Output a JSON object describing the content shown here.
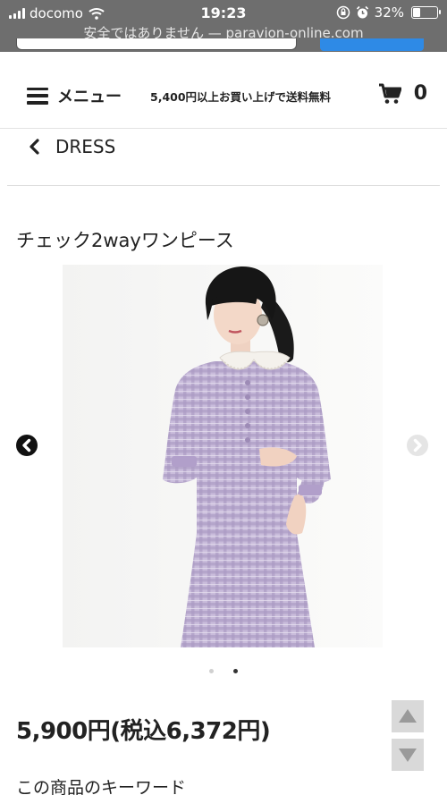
{
  "status_bar": {
    "carrier": "docomo",
    "time": "19:23",
    "battery_percent": "32%",
    "battery_level": 0.32,
    "url_text": "安全ではありません — paravion-online.com"
  },
  "header": {
    "menu_label": "メニュー",
    "shipping_notice": "5,400円以上お買い上げで送料無料",
    "cart_count": "0"
  },
  "breadcrumb": {
    "label": "DRESS"
  },
  "product": {
    "title": "チェック2wayワンピース",
    "price": "5,900円(税込6,372円)",
    "carousel": {
      "total_slides": 2,
      "active_slide": 2
    },
    "keywords_heading": "この商品のキーワード"
  },
  "colors": {
    "status_bar_bg": "#6e6e6e",
    "search_button": "#2e8ae6",
    "dress_lilac": "#b7a7cc",
    "text": "#222222"
  },
  "icons": {
    "menu": "hamburger-icon",
    "cart": "cart-icon",
    "back": "chevron-left-icon",
    "carousel_prev": "arrow-left-circle-icon",
    "carousel_next": "arrow-right-circle-icon",
    "scroll_up": "triangle-up-icon",
    "scroll_down": "triangle-down-icon"
  }
}
